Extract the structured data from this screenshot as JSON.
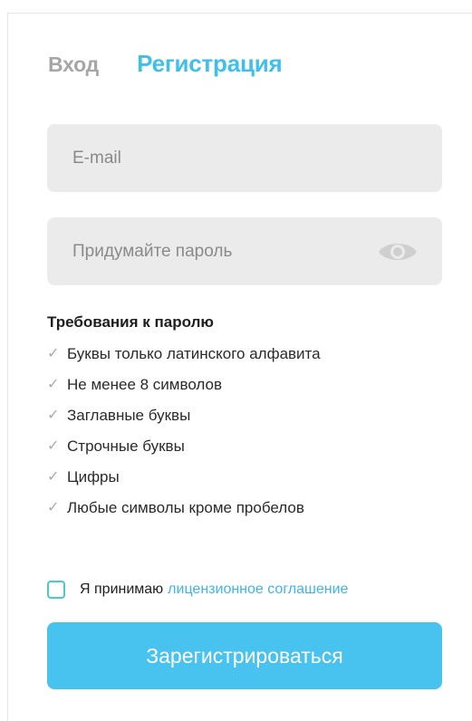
{
  "tabs": {
    "login_label": "Вход",
    "register_label": "Регистрация"
  },
  "form": {
    "email_placeholder": "E-mail",
    "email_value": "",
    "password_placeholder": "Придумайте пароль",
    "password_value": "",
    "password_toggle_icon": "eye-icon"
  },
  "requirements": {
    "title": "Требования к паролю",
    "check_icon": "check-icon",
    "items": [
      {
        "label": "Буквы только латинского алфавита"
      },
      {
        "label": "Не менее 8 символов"
      },
      {
        "label": "Заглавные буквы"
      },
      {
        "label": "Строчные буквы"
      },
      {
        "label": "Цифры"
      },
      {
        "label": "Любые символы кроме пробелов"
      }
    ]
  },
  "agreement": {
    "checked": false,
    "text": "Я принимаю",
    "link_text": "лицензионное соглашение"
  },
  "submit": {
    "label": "Зарегистрироваться"
  },
  "colors": {
    "accent": "#48c3ef",
    "tab_active": "#3fc0eb",
    "tab_inactive": "#a6a6a6",
    "field_bg": "#ebebeb",
    "checkbox_border": "#4fc7c4",
    "check_mark": "#a9a9a9"
  }
}
